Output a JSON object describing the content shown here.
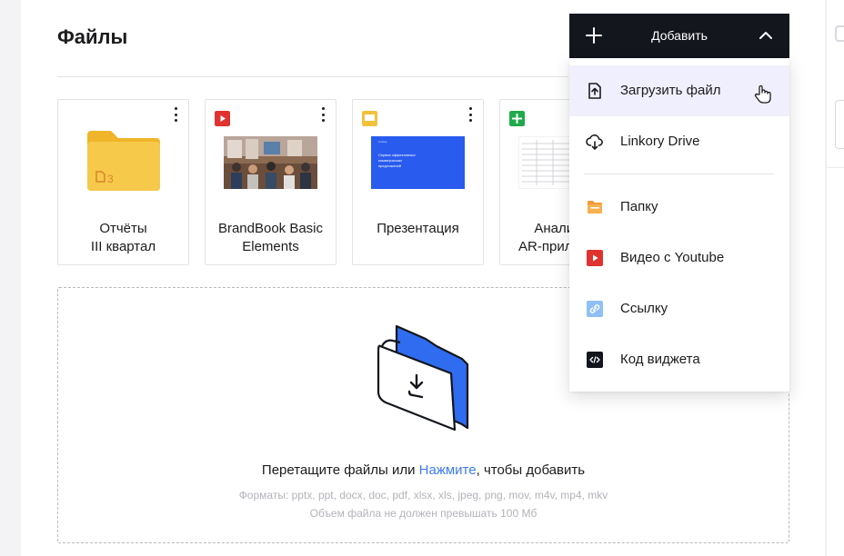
{
  "page": {
    "title": "Файлы"
  },
  "files": [
    {
      "name": "Отчёты\nIII квартал",
      "type_icon": "folder-icon",
      "count": "3"
    },
    {
      "name": "BrandBook Basic\nElements",
      "type_icon": "video-icon"
    },
    {
      "name": "Презентация",
      "type_icon": "presentation-icon",
      "thumb_lines": [
        "Linkory",
        "Сервис эффективных",
        "коммерческих",
        "предложений"
      ]
    },
    {
      "name": "Анализ\nAR-прило",
      "type_icon": "spreadsheet-icon"
    }
  ],
  "dropzone": {
    "text_before": "Перетащите файлы или ",
    "link": "Нажмите",
    "text_after": ", чтобы добавить",
    "formats": "Форматы: pptx, ppt, docx, doc, pdf, xlsx, xls, jpeg, png, mov, m4v, mp4, mkv",
    "size_limit": "Объем файла не должен превышать 100 Мб"
  },
  "add_menu": {
    "label": "Добавить",
    "items": [
      {
        "label": "Загрузить файл",
        "icon": "upload-icon"
      },
      {
        "label": "Linkory Drive",
        "icon": "cloud-download-icon"
      },
      {
        "label": "Папку",
        "icon": "folder-icon"
      },
      {
        "label": "Видео с Youtube",
        "icon": "youtube-icon"
      },
      {
        "label": "Ссылку",
        "icon": "link-icon"
      },
      {
        "label": "Код виджета",
        "icon": "code-icon"
      }
    ]
  },
  "colors": {
    "accent": "#3d7bf2",
    "folder": "#f5c342",
    "video": "#e0332f",
    "presentation": "#f3c23b",
    "spreadsheet": "#1faa4b",
    "dark": "#13161d"
  }
}
